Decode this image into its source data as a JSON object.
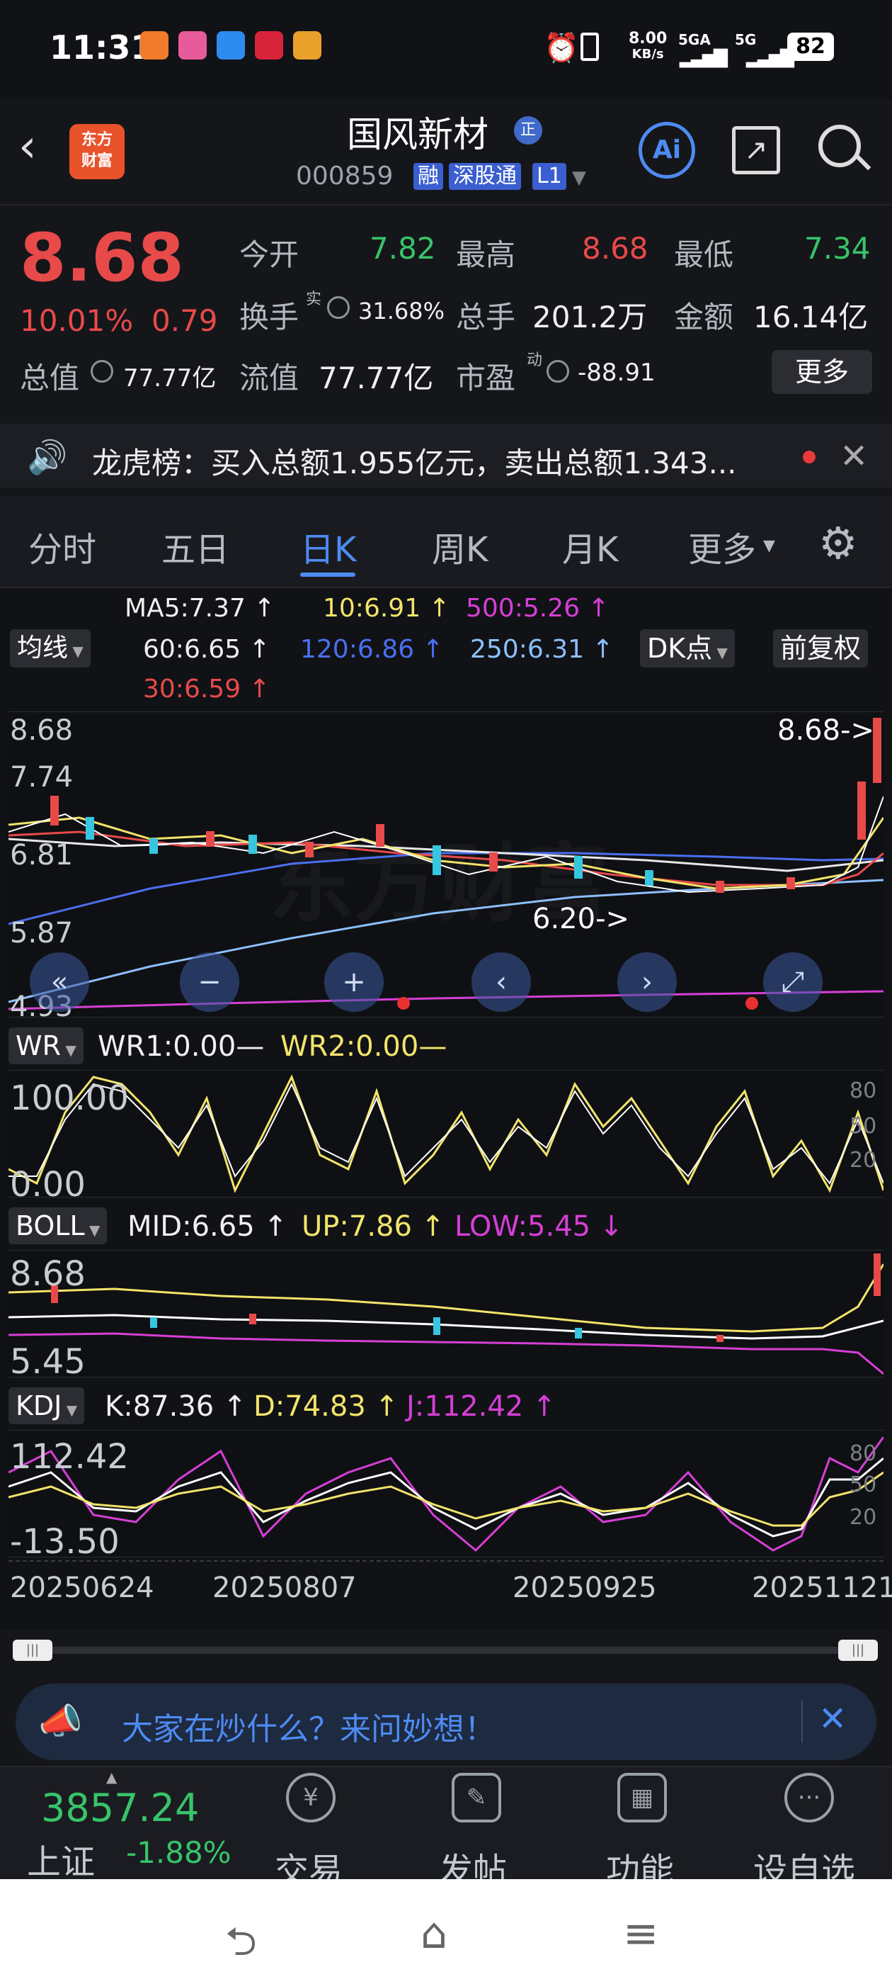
{
  "status": {
    "time": "11:31",
    "net_speed": "8.00",
    "net_unit": "KB/s",
    "sig1": "5GA",
    "sig2": "5G",
    "battery": "82"
  },
  "header": {
    "title": "国风新材",
    "badge": "正",
    "code": "000859",
    "tags": [
      "融",
      "深股通",
      "L1"
    ],
    "logo_line1": "东方",
    "logo_line2": "财富"
  },
  "quote": {
    "price": "8.68",
    "change_pct": "10.01%",
    "change": "0.79",
    "open_label": "今开",
    "open": "7.82",
    "high_label": "最高",
    "high": "8.68",
    "low_label": "最低",
    "low": "7.34",
    "turnover_label": "换手",
    "turnover_sup": "实",
    "turnover": "31.68%",
    "volume_label": "总手",
    "volume": "201.2万",
    "amount_label": "金额",
    "amount": "16.14亿",
    "mcap_label": "总值",
    "mcap": "77.77亿",
    "float_label": "流值",
    "float": "77.77亿",
    "pe_label": "市盈",
    "pe_sup": "动",
    "pe": "-88.91",
    "more": "更多"
  },
  "notice": {
    "text": "龙虎榜：买入总额1.955亿元，卖出总额1.343..."
  },
  "tabs": [
    "分时",
    "五日",
    "日K",
    "周K",
    "月K",
    "更多"
  ],
  "active_tab": "日K",
  "ma": {
    "selector": "均线",
    "ma5": "MA5:7.37 ↑",
    "ma10": "10:6.91 ↑",
    "ma500": "500:5.26 ↑",
    "ma60": "60:6.65 ↑",
    "ma120": "120:6.86 ↑",
    "ma250": "250:6.31 ↑",
    "ma30": "30:6.59 ↑",
    "dk": "DK点",
    "adjust": "前复权"
  },
  "kchart": {
    "y_labels": [
      "8.68",
      "7.74",
      "6.81",
      "5.87",
      "4.93"
    ],
    "max_annot": "8.68->",
    "min_annot": "6.20->",
    "watermark": "东方财富"
  },
  "wr": {
    "selector": "WR",
    "wr1": "WR1:0.00—",
    "wr2": "WR2:0.00—",
    "top": "100.00",
    "bottom": "0.00",
    "r80": "80",
    "r50": "50",
    "r20": "20"
  },
  "boll": {
    "selector": "BOLL",
    "mid": "MID:6.65 ↑",
    "up": "UP:7.86 ↑",
    "low": "LOW:5.45 ↓",
    "top": "8.68",
    "bottom": "5.45"
  },
  "kdj": {
    "selector": "KDJ",
    "k": "K:87.36 ↑",
    "d": "D:74.83 ↑",
    "j": "J:112.42 ↑",
    "top": "112.42",
    "bottom": "-13.50",
    "r80": "80",
    "r50": "50",
    "r20": "20"
  },
  "dates": [
    "20250624",
    "20250807",
    "20250925",
    "20251121"
  ],
  "ask": {
    "text": "大家在炒什么？来问妙想！"
  },
  "bottom": {
    "index_value": "3857.24",
    "index_name": "上证",
    "index_change": "-1.88%",
    "items": [
      "交易",
      "发帖",
      "功能",
      "设自选"
    ]
  },
  "colors": {
    "red": "#e84a4a",
    "green": "#37c46a",
    "blue": "#4d8bf3",
    "yellow": "#f2e46a",
    "magenta": "#d63fd6"
  }
}
